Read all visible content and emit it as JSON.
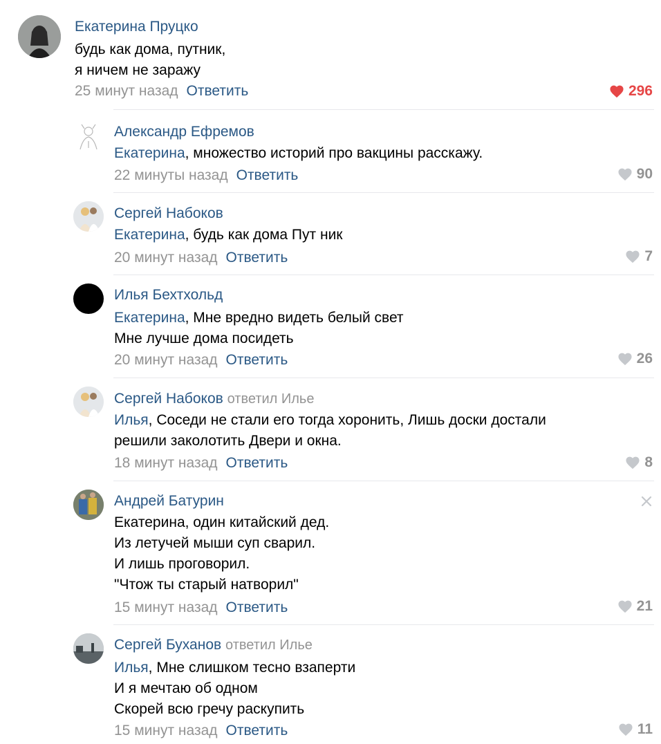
{
  "colors": {
    "link": "#2a5885",
    "muted": "#939393",
    "like_active": "#e64646",
    "like_inactive": "#c5c8cc",
    "separator": "#e7e8ec"
  },
  "icons": {
    "like": "heart-icon",
    "close": "close-icon"
  },
  "comments": [
    {
      "author": "Екатерина Пруцко",
      "replied_to": "",
      "addressee": "",
      "lines": [
        "будь как дома, путник,",
        "я ничем не заражу"
      ],
      "time": "25 минут назад",
      "reply": "Ответить",
      "likes": "296",
      "liked": true
    },
    {
      "author": "Александр Ефремов",
      "replied_to": "",
      "addressee": "Екатерина",
      "lines": [
        ", множество историй про вакцины расскажу."
      ],
      "time": "22 минуты назад",
      "reply": "Ответить",
      "likes": "90",
      "liked": false
    },
    {
      "author": "Сергей Набоков",
      "replied_to": "",
      "addressee": "Екатерина",
      "lines": [
        ", будь как дома Пут ник"
      ],
      "time": "20 минут назад",
      "reply": "Ответить",
      "likes": "7",
      "liked": false
    },
    {
      "author": "Илья Бехтхольд",
      "replied_to": "",
      "addressee": "Екатерина",
      "lines": [
        ", Мне вредно видеть белый свет",
        "Мне лучше дома посидеть"
      ],
      "time": "20 минут назад",
      "reply": "Ответить",
      "likes": "26",
      "liked": false
    },
    {
      "author": "Сергей Набоков",
      "replied_to": "ответил Илье",
      "addressee": "Илья",
      "lines": [
        ", Соседи не стали его тогда хоронить, Лишь доски достали",
        "решили заколотить Двери и окна."
      ],
      "time": "18 минут назад",
      "reply": "Ответить",
      "likes": "8",
      "liked": false
    },
    {
      "author": "Андрей Батурин",
      "replied_to": "",
      "addressee": "",
      "lines": [
        "Екатерина, один китайский дед.",
        "Из летучей мыши суп сварил.",
        "И лишь проговорил.",
        "\"Чтож ты старый натворил\""
      ],
      "time": "15 минут назад",
      "reply": "Ответить",
      "likes": "21",
      "liked": false
    },
    {
      "author": "Сергей Буханов",
      "replied_to": "ответил Илье",
      "addressee": "Илья",
      "lines": [
        ", Мне слишком тесно взаперти",
        "И я мечтаю об одном",
        "Скорей всю гречу раскупить"
      ],
      "time": "15 минут назад",
      "reply": "Ответить",
      "likes": "11",
      "liked": false
    }
  ]
}
